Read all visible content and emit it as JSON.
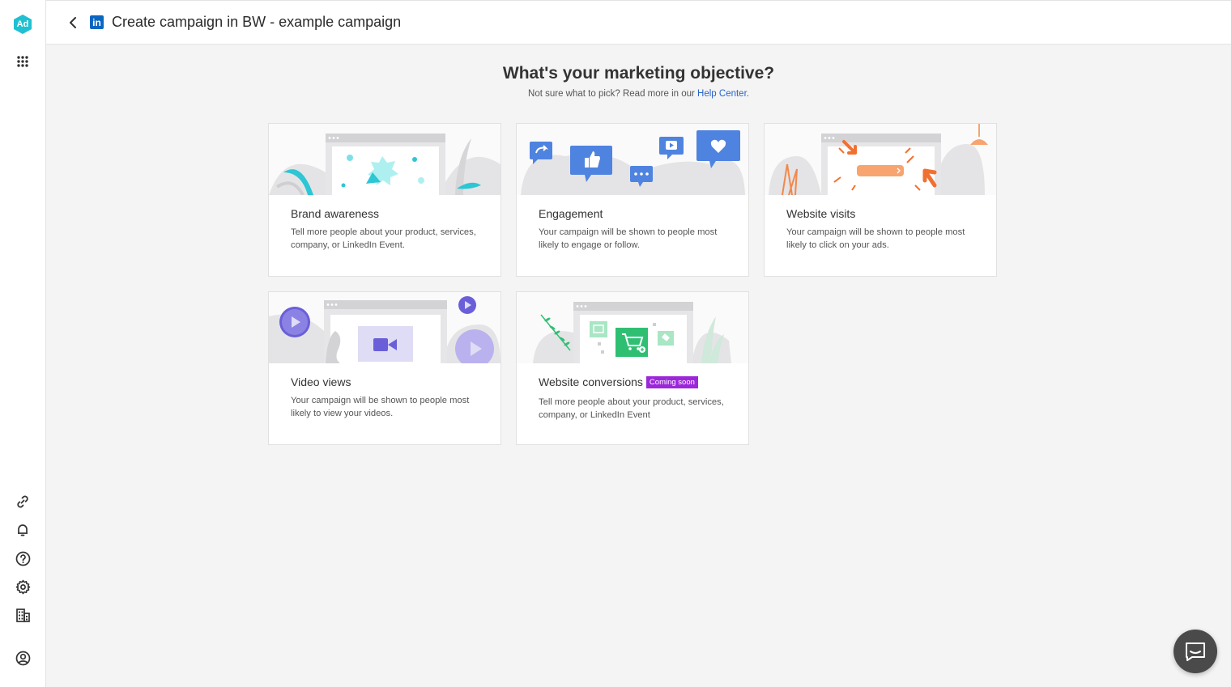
{
  "app": {
    "logo_text": "Ad",
    "accent_color": "#1fc0d1"
  },
  "header": {
    "title": "Create campaign in BW - example campaign",
    "network_logo": "in"
  },
  "main": {
    "heading": "What's your marketing objective?",
    "sub_prefix": "Not sure what to pick? Read more in our ",
    "help_link": "Help Center",
    "sub_suffix": "."
  },
  "objectives": [
    {
      "title": "Brand awareness",
      "description": "Tell more people about your product, services, company, or LinkedIn Event."
    },
    {
      "title": "Engagement",
      "description": "Your campaign will be shown to people most likely to engage or follow."
    },
    {
      "title": "Website visits",
      "description": "Your campaign will be shown to people most likely to click on your ads."
    },
    {
      "title": "Video views",
      "description": "Your campaign will be shown to people most likely to view your videos."
    },
    {
      "title": "Website conversions",
      "badge": "Coming soon",
      "description": "Tell more people about your product, services, company, or LinkedIn Event"
    }
  ],
  "colors": {
    "badge": "#9c27d9",
    "link": "#2563c9",
    "linkedin": "#0a66c2"
  }
}
